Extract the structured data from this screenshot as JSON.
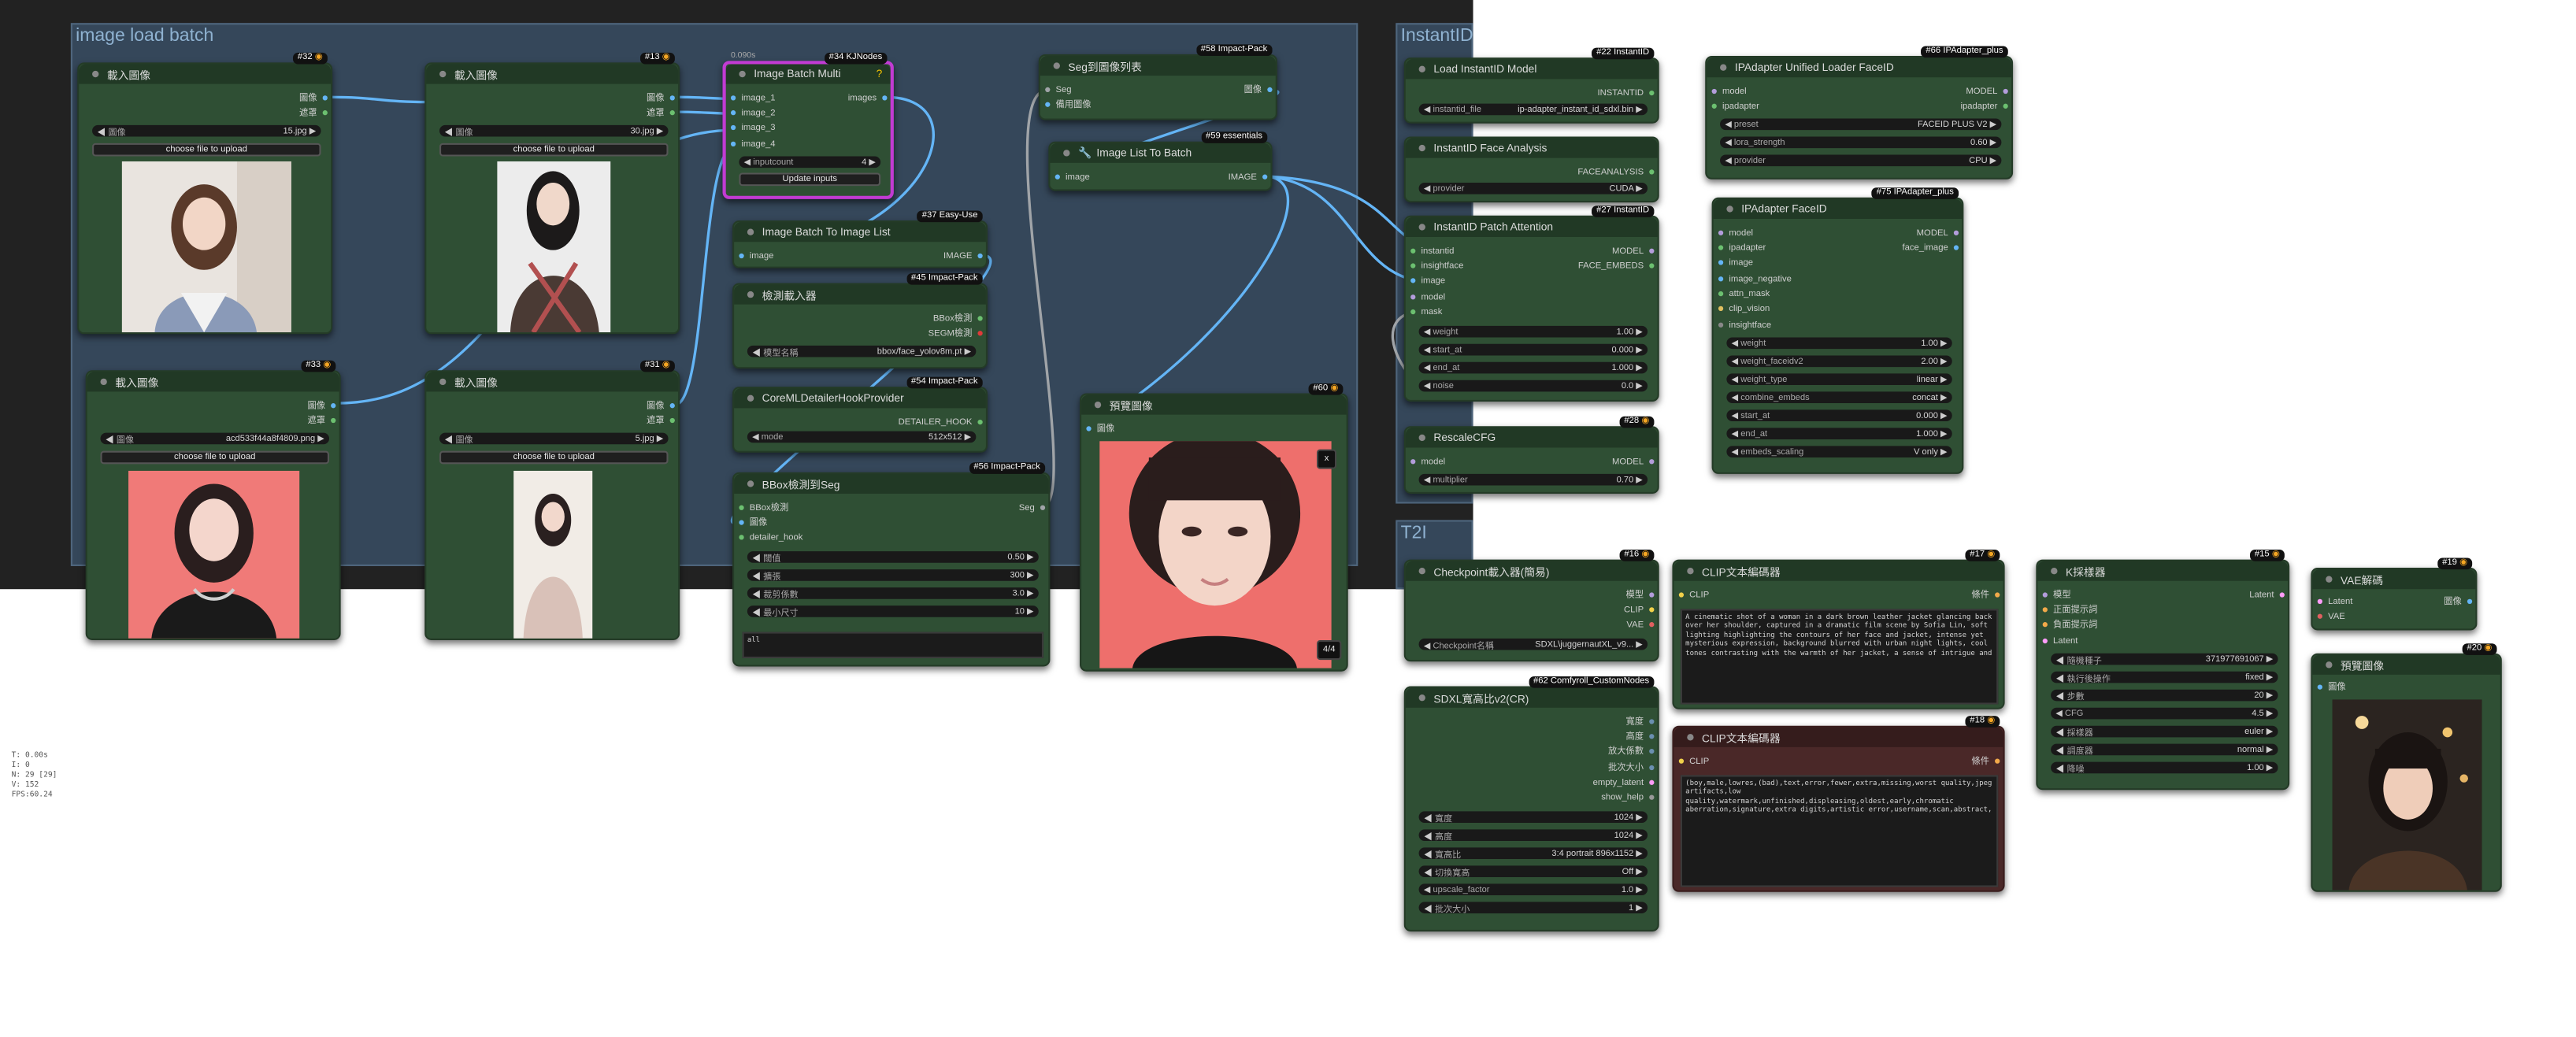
{
  "groups": {
    "image_load_batch": "image load batch",
    "instantid": "InstantID",
    "t2i": "T2I"
  },
  "tags": {
    "n32": "#32",
    "n13": "#13",
    "n33": "#33",
    "n31": "#31",
    "n34": "#34 KJNodes",
    "n58": "#58 Impact-Pack",
    "n59": "#59 essentials",
    "n37": "#37 Easy-Use",
    "n45": "#45 Impact-Pack",
    "n54": "#54 Impact-Pack",
    "n56": "#56 Impact-Pack",
    "n60": "#60",
    "n22": "#22 InstantID",
    "n66": "#66 IPAdapter_plus",
    "n75": "#75 IPAdapter_plus",
    "n27": "#27 InstantID",
    "n28": "#28",
    "n16": "#16",
    "n17": "#17",
    "n15": "#15",
    "n19": "#19",
    "n20": "#20",
    "n62": "#62 Comfyroll_CustomNodes",
    "n18": "#18"
  },
  "load_image": {
    "title": "載入圖像",
    "out_image": "圖像",
    "out_mask": "遮罩",
    "widget_label": "圖像",
    "upload_button": "choose file to upload",
    "files": {
      "n32": "15.jpg",
      "n13": "30.jpg",
      "n33": "acd533f44a8f4809.png",
      "n31": "5.jpg"
    }
  },
  "image_batch_multi": {
    "title": "Image Batch Multi",
    "timing": "0.090s",
    "inputs": [
      "image_1",
      "image_2",
      "image_3",
      "image_4"
    ],
    "output": "images",
    "inputcount_label": "inputcount",
    "inputcount_value": "4",
    "update_button": "Update inputs"
  },
  "seg_to_list": {
    "title": "Seg到圖像列表",
    "in_seg": "Seg",
    "in_fallback": "備用圖像",
    "out": "圖像"
  },
  "list_to_batch": {
    "title": "Image List To Batch",
    "in": "image",
    "out": "IMAGE"
  },
  "batch_to_list": {
    "title": "Image Batch To Image List",
    "in": "image",
    "out": "IMAGE"
  },
  "detector_loader": {
    "title": "檢測載入器",
    "out_bbox": "BBox檢測",
    "out_segm": "SEGM檢測",
    "model_label": "模型名稱",
    "model_value": "bbox/face_yolov8m.pt"
  },
  "coreml": {
    "title": "CoreMLDetailerHookProvider",
    "out": "DETAILER_HOOK",
    "mode_label": "mode",
    "mode_value": "512x512"
  },
  "bbox_seg": {
    "title": "BBox檢測到Seg",
    "inputs": [
      "BBox檢測",
      "圖像",
      "detailer_hook"
    ],
    "out": "Seg",
    "widgets": [
      {
        "label": "閾值",
        "value": "0.50"
      },
      {
        "label": "擴張",
        "value": "300"
      },
      {
        "label": "裁剪係數",
        "value": "3.0"
      },
      {
        "label": "最小尺寸",
        "value": "10"
      }
    ],
    "text": "all"
  },
  "preview_60": {
    "title": "預覽圖像",
    "in": "圖像",
    "counter": "4/4",
    "close": "x"
  },
  "instantid_loader": {
    "title": "Load InstantID Model",
    "out": "INSTANTID",
    "file_label": "instantid_file",
    "file_value": "ip-adapter_instant_id_sdxl.bin"
  },
  "face_analysis": {
    "title": "InstantID Face Analysis",
    "out": "FACEANALYSIS",
    "provider_label": "provider",
    "provider_value": "CUDA"
  },
  "patch_attention": {
    "title": "InstantID Patch Attention",
    "inputs": [
      "instantid",
      "insightface",
      "image",
      "model",
      "mask"
    ],
    "out_model": "MODEL",
    "out_embeds": "FACE_EMBEDS",
    "widgets": [
      {
        "label": "weight",
        "value": "1.00"
      },
      {
        "label": "start_at",
        "value": "0.000"
      },
      {
        "label": "end_at",
        "value": "1.000"
      },
      {
        "label": "noise",
        "value": "0.0"
      }
    ]
  },
  "rescale_cfg": {
    "title": "RescaleCFG",
    "in": "model",
    "out": "MODEL",
    "mult_label": "multiplier",
    "mult_value": "0.70"
  },
  "ipa_loader": {
    "title": "IPAdapter Unified Loader FaceID",
    "in_model": "model",
    "in_ipadapter": "ipadapter",
    "out_model": "MODEL",
    "out_ipadapter": "ipadapter",
    "widgets": [
      {
        "label": "preset",
        "value": "FACEID PLUS V2"
      },
      {
        "label": "lora_strength",
        "value": "0.60"
      },
      {
        "label": "provider",
        "value": "CPU"
      }
    ]
  },
  "ipa_faceid": {
    "title": "IPAdapter FaceID",
    "inputs": [
      "model",
      "ipadapter",
      "image",
      "image_negative",
      "attn_mask",
      "clip_vision",
      "insightface"
    ],
    "out_model": "MODEL",
    "out_face": "face_image",
    "widgets": [
      {
        "label": "weight",
        "value": "1.00"
      },
      {
        "label": "weight_faceidv2",
        "value": "2.00"
      },
      {
        "label": "weight_type",
        "value": "linear"
      },
      {
        "label": "combine_embeds",
        "value": "concat"
      },
      {
        "label": "start_at",
        "value": "0.000"
      },
      {
        "label": "end_at",
        "value": "1.000"
      },
      {
        "label": "embeds_scaling",
        "value": "V only"
      }
    ]
  },
  "checkpoint": {
    "title": "Checkpoint載入器(簡易)",
    "outs": [
      "模型",
      "CLIP",
      "VAE"
    ],
    "name_label": "Checkpoint名稱",
    "name_value": "SDXL\\juggernautXL_v9..."
  },
  "clip_pos": {
    "title": "CLIP文本編碼器",
    "in": "CLIP",
    "out": "條件",
    "text": "A cinematic shot of a woman in a dark brown leather jacket glancing back over her shoulder, captured in a dramatic film scene by Sofia Lin, soft lighting highlighting the contours of her face and jacket, intense yet mysterious expression, background blurred with urban night lights, cool tones contrasting with the warmth of her jacket, a sense of intrigue and"
  },
  "clip_neg": {
    "title": "CLIP文本編碼器",
    "in": "CLIP",
    "out": "條件",
    "text": "(boy,male,lowres,(bad),text,error,fewer,extra,missing,worst quality,jpeg artifacts,low quality,watermark,unfinished,displeasing,oldest,early,chromatic aberration,signature,extra digits,artistic error,username,scan,abstract,"
  },
  "sdxl_ratio": {
    "title": "SDXL寬高比v2(CR)",
    "outs": [
      "寬度",
      "高度",
      "放大係數",
      "批次大小",
      "empty_latent",
      "show_help"
    ],
    "widgets": [
      {
        "label": "寬度",
        "value": "1024"
      },
      {
        "label": "高度",
        "value": "1024"
      },
      {
        "label": "寬高比",
        "value": "3:4 portrait 896x1152"
      },
      {
        "label": "切換寬高",
        "value": "Off"
      },
      {
        "label": "upscale_factor",
        "value": "1.0"
      },
      {
        "label": "批次大小",
        "value": "1"
      }
    ]
  },
  "ksampler": {
    "title": "K採樣器",
    "inputs": [
      "模型",
      "正面提示詞",
      "負面提示詞",
      "Latent"
    ],
    "out": "Latent",
    "widgets": [
      {
        "label": "隨機種子",
        "value": "371977691067"
      },
      {
        "label": "執行後操作",
        "value": "fixed"
      },
      {
        "label": "步數",
        "value": "20"
      },
      {
        "label": "CFG",
        "value": "4.5"
      },
      {
        "label": "採樣器",
        "value": "euler"
      },
      {
        "label": "調度器",
        "value": "normal"
      },
      {
        "label": "降噪",
        "value": "1.00"
      }
    ]
  },
  "vae_decode": {
    "title": "VAE解碼",
    "inputs": [
      "Latent",
      "VAE"
    ],
    "out": "圖像"
  },
  "preview_20": {
    "title": "預覽圖像",
    "in": "圖像"
  },
  "stats": [
    "T: 0.00s",
    "I: 0",
    "N: 29 [29]",
    "V: 152",
    "FPS:60.24"
  ],
  "colors": {
    "canvas": "#222222",
    "group": "#35475a",
    "node": "#2f4f34",
    "wire_image": "#64b5f6",
    "wire_other": "#a0a4a8",
    "selection": "#c23bd3"
  }
}
